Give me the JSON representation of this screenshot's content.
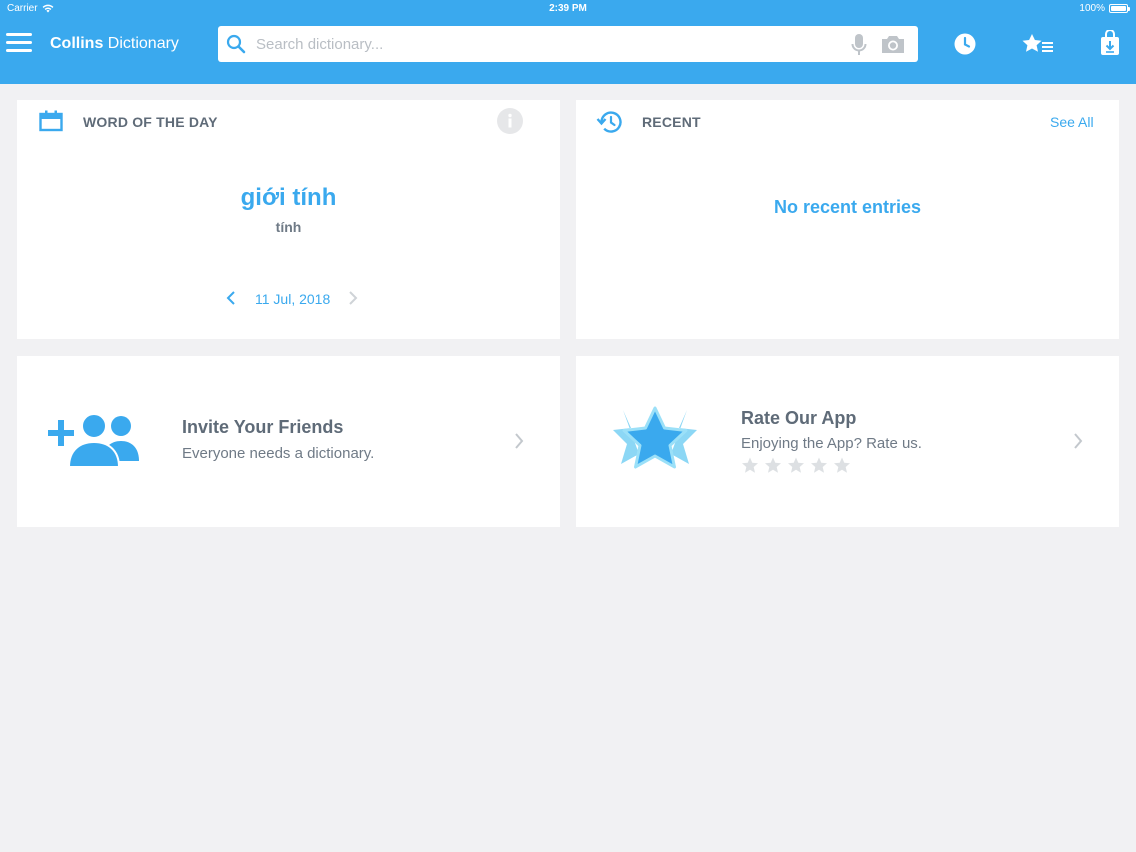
{
  "status_bar": {
    "carrier": "Carrier",
    "time": "2:39 PM",
    "battery": "100%"
  },
  "header": {
    "app_name_bold": "Collins",
    "app_name_rest": " Dictionary",
    "search_placeholder": "Search dictionary...",
    "icons": [
      "menu-icon",
      "search-icon",
      "microphone-icon",
      "camera-icon",
      "history-clock-icon",
      "favorites-icon",
      "store-download-icon"
    ]
  },
  "word_of_the_day": {
    "title": "WORD OF THE DAY",
    "word": "giới tính",
    "subtitle": "tính",
    "date": "11 Jul, 2018"
  },
  "recent": {
    "title": "RECENT",
    "see_all": "See All",
    "empty_text": "No recent entries"
  },
  "invite": {
    "title": "Invite Your Friends",
    "subtitle": "Everyone needs a dictionary."
  },
  "rate": {
    "title": "Rate Our App",
    "subtitle": "Enjoying the App? Rate us.",
    "rating": 0,
    "max_rating": 5
  },
  "colors": {
    "accent": "#3aa9ee",
    "background": "#f1f1f3",
    "card": "#ffffff",
    "text": "#5f6b78"
  }
}
